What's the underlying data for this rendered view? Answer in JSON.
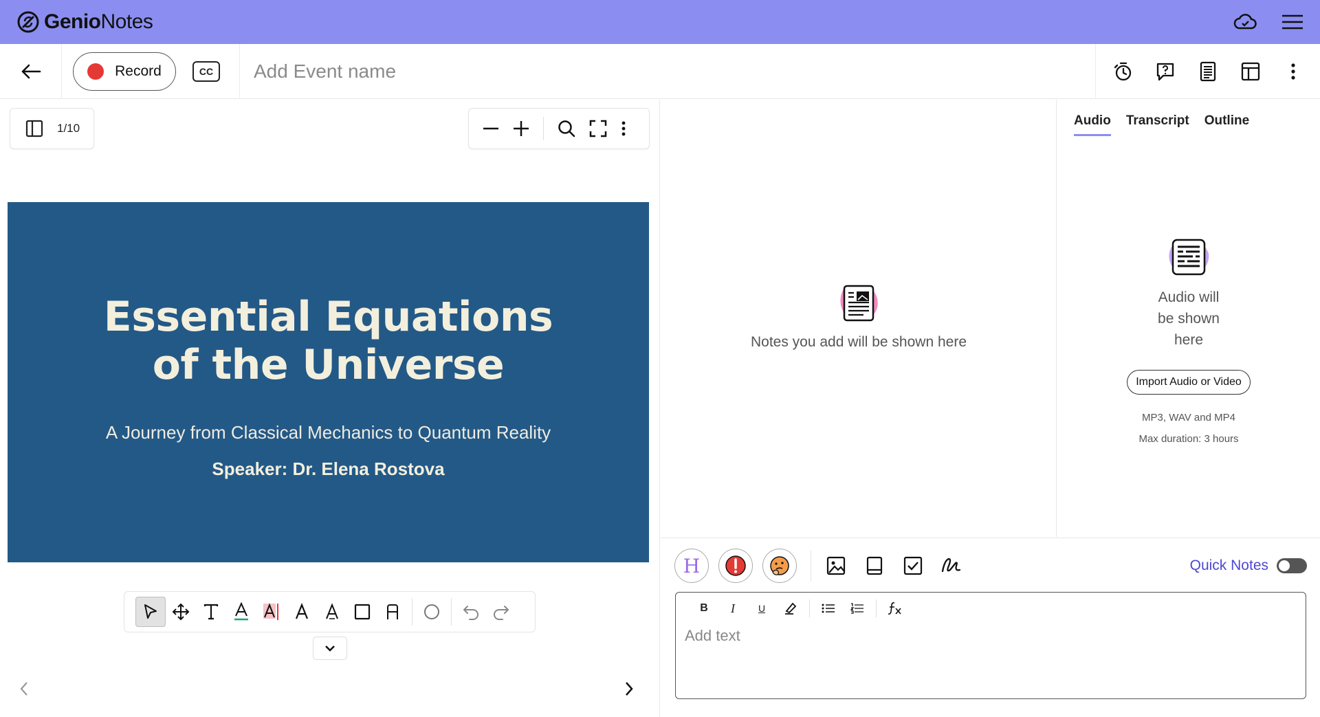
{
  "app": {
    "logo_name_bold": "Genio",
    "logo_name_rest": "Notes",
    "brand_color": "#8b8ef0"
  },
  "toolbar": {
    "record_label": "Record",
    "cc_label": "CC",
    "event_placeholder": "Add Event name"
  },
  "slides": {
    "page_indicator": "1/10"
  },
  "slide": {
    "title_line1": "Essential Equations",
    "title_line2": "of the Universe",
    "subtitle": "A Journey from Classical Mechanics to Quantum Reality",
    "speaker": "Speaker: Dr. Elena Rostova",
    "background": "#235987"
  },
  "notes": {
    "empty_text": "Notes you add will be shown here"
  },
  "media": {
    "tabs": [
      {
        "label": "Audio",
        "active": true
      },
      {
        "label": "Transcript",
        "active": false
      },
      {
        "label": "Outline",
        "active": false
      }
    ],
    "empty_line1": "Audio will",
    "empty_line2": "be shown",
    "empty_line3": "here",
    "import_label": "Import Audio or Video",
    "formats": "MP3, WAV and MP4",
    "max_duration": "Max duration: 3 hours"
  },
  "editor": {
    "heading_button": "H",
    "quick_notes_label": "Quick Notes",
    "quick_notes_enabled": false,
    "placeholder": "Add text",
    "format_buttons": [
      "B",
      "I",
      "U"
    ]
  },
  "icons": {
    "appbar": [
      "cloud-icon",
      "hamburger-menu-icon"
    ],
    "toolbar_right": [
      "timer-icon",
      "question-chat-icon",
      "notes-icon",
      "layout-icon",
      "more-vertical-icon"
    ],
    "annotation_tools": [
      "select-pointer-icon",
      "move-icon",
      "text-tool-icon",
      "text-color-icon",
      "text-highlight-icon",
      "text-style-icon",
      "text-outline-icon",
      "rectangle-icon",
      "shape-text-icon",
      "circle-icon",
      "undo-icon",
      "redo-icon"
    ]
  }
}
